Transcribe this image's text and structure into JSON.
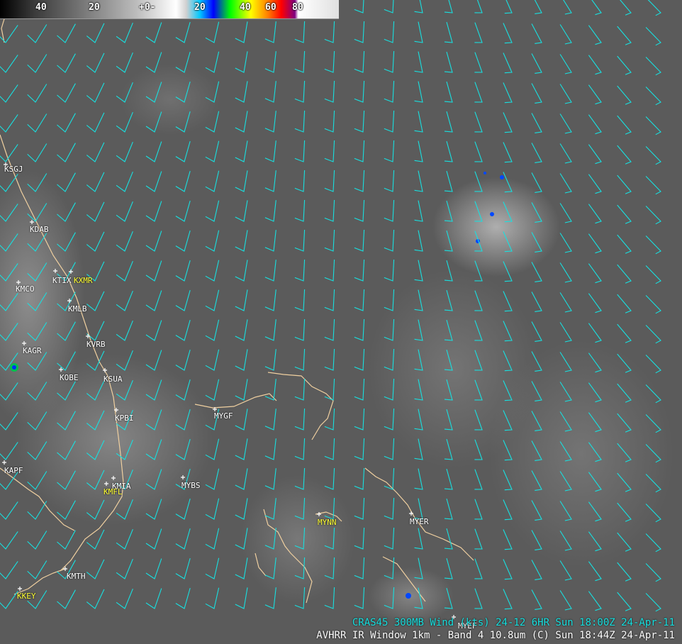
{
  "colorbar": {
    "ticks": [
      "40",
      "20",
      "+0-",
      "20",
      "40",
      "60",
      "80"
    ]
  },
  "stations": [
    {
      "id": "KSGJ",
      "color": "white"
    },
    {
      "id": "KDAB",
      "color": "white"
    },
    {
      "id": "KTIX",
      "color": "white"
    },
    {
      "id": "KXMR",
      "color": "yellow"
    },
    {
      "id": "KMCO",
      "color": "white"
    },
    {
      "id": "KMLB",
      "color": "white"
    },
    {
      "id": "KVRB",
      "color": "white"
    },
    {
      "id": "KAGR",
      "color": "white"
    },
    {
      "id": "KOBE",
      "color": "white"
    },
    {
      "id": "KSUA",
      "color": "white"
    },
    {
      "id": "KPBI",
      "color": "white"
    },
    {
      "id": "MYGF",
      "color": "white"
    },
    {
      "id": "KAPF",
      "color": "white"
    },
    {
      "id": "KMIA",
      "color": "white"
    },
    {
      "id": "KMFL",
      "color": "yellow"
    },
    {
      "id": "MYBS",
      "color": "white"
    },
    {
      "id": "MYNN",
      "color": "yellow"
    },
    {
      "id": "MYER",
      "color": "white"
    },
    {
      "id": "KMTH",
      "color": "white"
    },
    {
      "id": "KKEY",
      "color": "yellow"
    },
    {
      "id": "MYEF",
      "color": "white"
    }
  ],
  "captions": {
    "wind": "CRAS45 300MB  Wind (kts)  24-12   6HR Sun 18:00Z 24-Apr-11",
    "satellite": "AVHRR IR Window 1km - Band 4 10.8um (C)  Sun 18:44Z 24-Apr-11"
  },
  "colors": {
    "background": "#5b5b5b",
    "barb": "#18e0e0",
    "coastline": "#f0d0a0",
    "station_white": "#ffffff",
    "station_yellow": "#ffff33"
  }
}
